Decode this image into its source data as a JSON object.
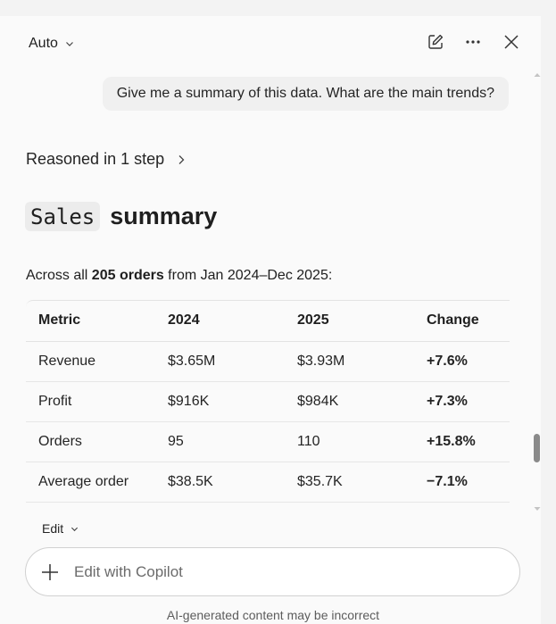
{
  "header": {
    "mode_label": "Auto"
  },
  "conversation": {
    "user_message": "Give me a summary of this data. What are the main trends?",
    "reasoning_label": "Reasoned in 1 step"
  },
  "response": {
    "title_code": "Sales",
    "title_word": "summary",
    "intro_prefix": "Across all ",
    "intro_bold": "205 orders",
    "intro_suffix": " from Jan 2024–Dec 2025:",
    "table": {
      "headers": [
        "Metric",
        "2024",
        "2025",
        "Change"
      ],
      "rows": [
        [
          "Revenue",
          "$3.65M",
          "$3.93M",
          "+7.6%"
        ],
        [
          "Profit",
          "$916K",
          "$984K",
          "+7.3%"
        ],
        [
          "Orders",
          "95",
          "110",
          "+15.8%"
        ],
        [
          "Average order",
          "$38.5K",
          "$35.7K",
          "−7.1%"
        ]
      ]
    }
  },
  "footer": {
    "edit_label": "Edit",
    "composer_placeholder": "Edit with Copilot",
    "disclaimer": "AI-generated content may be incorrect"
  }
}
